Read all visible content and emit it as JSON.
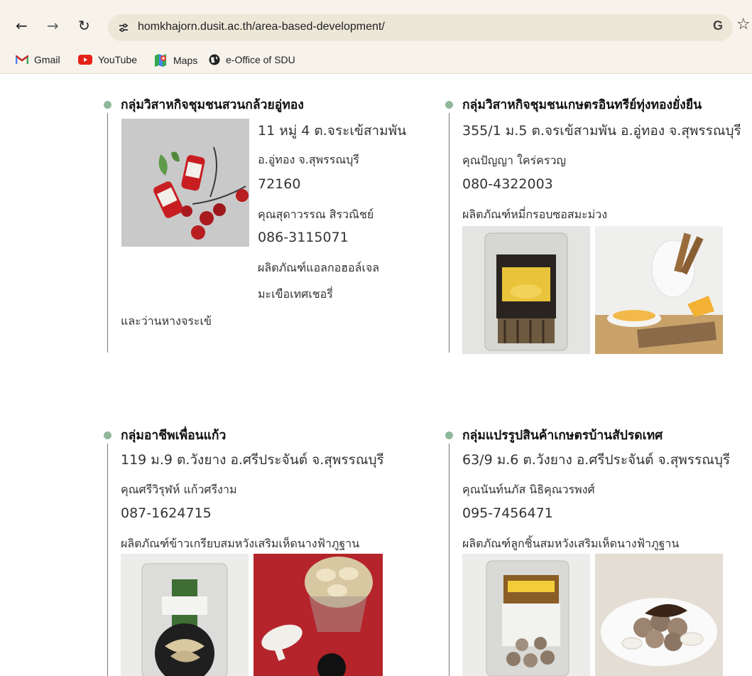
{
  "browser": {
    "url": "homkhajorn.dusit.ac.th/area-based-development/",
    "bookmarks": [
      {
        "label": "Gmail"
      },
      {
        "label": "YouTube"
      },
      {
        "label": "Maps"
      },
      {
        "label": "e-Office of SDU"
      }
    ]
  },
  "cards": [
    {
      "title": "กลุ่มวิสาหกิจชุมชนสวนกล้วยอู่ทอง",
      "lines": [
        "11 หมู่ 4 ต.จระเข้สามพัน",
        "อ.อู่ทอง จ.สุพรรณบุรี",
        "72160",
        "คุณสุดาวรรณ สิรวณิชย์",
        "086-3115071",
        "ผลิตภัณฑ์แอลกอฮอล์เจล",
        "มะเขือเทศเชอรี่",
        "และว่านหางจระเข้"
      ],
      "images": [
        "product-gel-photo"
      ]
    },
    {
      "title": "กลุ่มวิสาหกิจชุมชนเกษตรอินทรีย์ทุ่งทองยั่งยืน",
      "lines": [
        "355/1 ม.5 ต.จรเข้สามพัน อ.อู่ทอง จ.สุพรรณบุรี",
        "คุณปัญญา ใคร่ครวญ",
        "080-4322003",
        "ผลิตภัณฑ์หมี่กรอบซอสมะม่วง"
      ],
      "images": [
        "product-package-photo",
        "product-dish-photo"
      ]
    },
    {
      "title": "กลุ่มอาชีพเพื่อนแก้ว",
      "lines": [
        "119 ม.9 ต.วังยาง อ.ศรีประจันต์ จ.สุพรรณบุรี",
        "คุณศรีวิรุฬห์ แก้วศรีงาม",
        "087-1624715",
        "ผลิตภัณฑ์ข้าวเกรียบสมหวังเสริมเห็ดนางฟ้าภูฐาน"
      ],
      "images": [
        "product-package-photo",
        "product-crackers-photo"
      ]
    },
    {
      "title": "กลุ่มแปรรูปสินค้าเกษตรบ้านสัปรดเทศ",
      "lines": [
        "63/9 ม.6 ต.วังยาง อ.ศรีประจันต์ จ.สุพรรณบุรี",
        "คุณนันท์นภัส นิธิคุณวรพงศ์",
        "095-7456471",
        "ผลิตภัณฑ์ลูกชิ้นสมหวังเสริมเห็ดนางฟ้าภูฐาน"
      ],
      "images": [
        "product-package-photo",
        "product-meatball-photo"
      ]
    }
  ]
}
